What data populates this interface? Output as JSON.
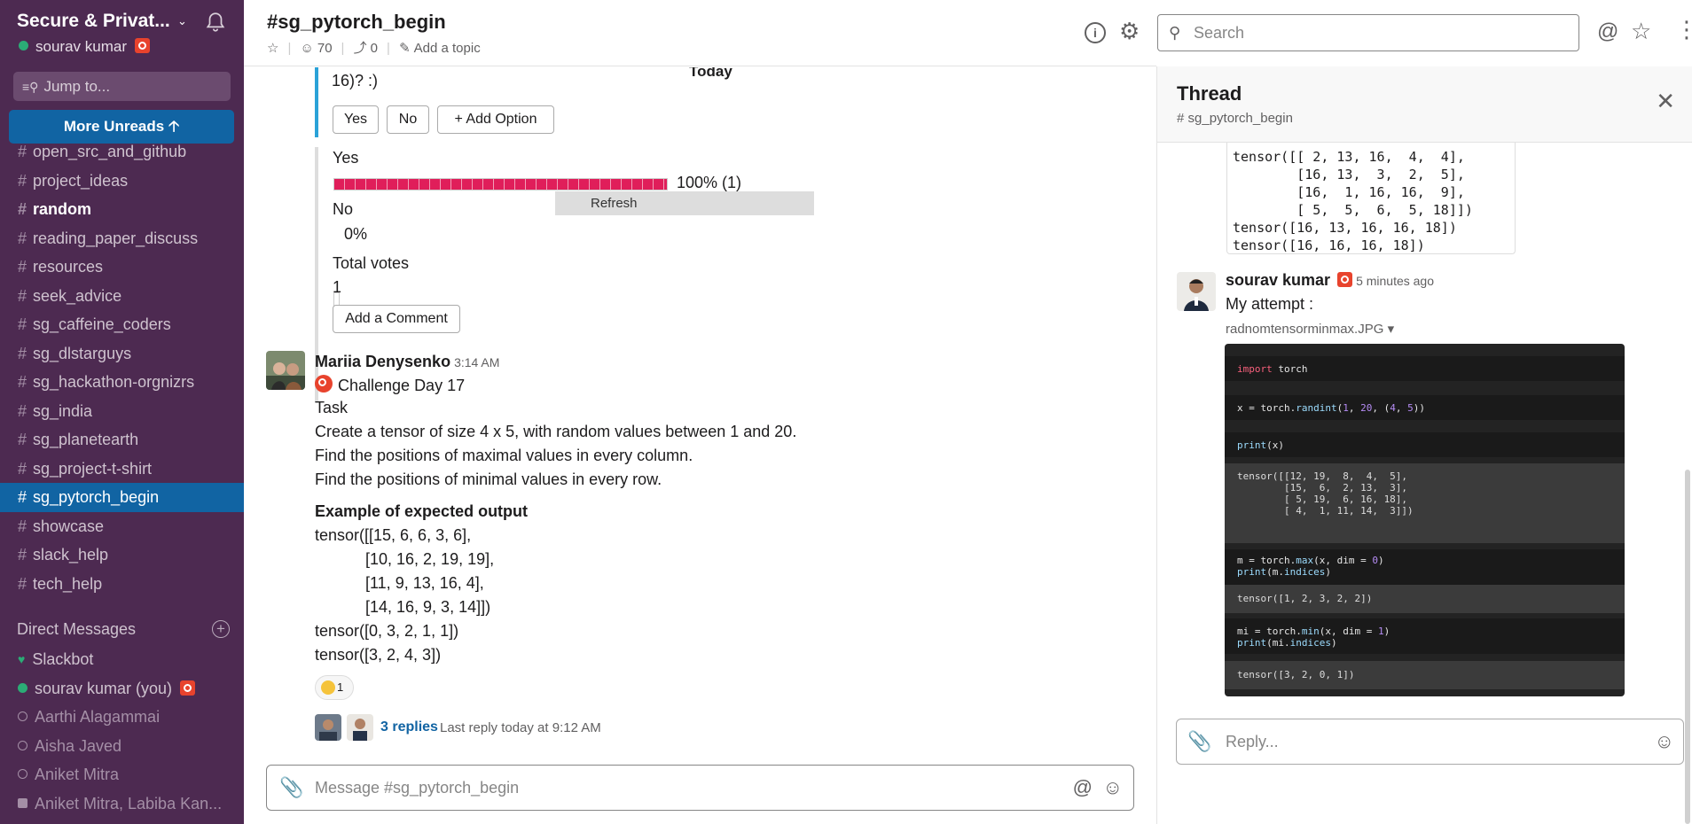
{
  "sidebar": {
    "workspace": "Secure & Privat...",
    "user": "sourav kumar",
    "jump": "Jump to...",
    "more_unreads": "More Unreads",
    "channels": [
      {
        "name": "open_src_and_github",
        "bold": false,
        "active": false
      },
      {
        "name": "project_ideas",
        "bold": false,
        "active": false
      },
      {
        "name": "random",
        "bold": true,
        "active": false
      },
      {
        "name": "reading_paper_discuss",
        "bold": false,
        "active": false
      },
      {
        "name": "resources",
        "bold": false,
        "active": false
      },
      {
        "name": "seek_advice",
        "bold": false,
        "active": false
      },
      {
        "name": "sg_caffeine_coders",
        "bold": false,
        "active": false
      },
      {
        "name": "sg_dlstarguys",
        "bold": false,
        "active": false
      },
      {
        "name": "sg_hackathon-orgnizrs",
        "bold": false,
        "active": false
      },
      {
        "name": "sg_india",
        "bold": false,
        "active": false
      },
      {
        "name": "sg_planetearth",
        "bold": false,
        "active": false
      },
      {
        "name": "sg_project-t-shirt",
        "bold": false,
        "active": false
      },
      {
        "name": "sg_pytorch_begin",
        "bold": false,
        "active": true
      },
      {
        "name": "showcase",
        "bold": false,
        "active": false
      },
      {
        "name": "slack_help",
        "bold": false,
        "active": false
      },
      {
        "name": "tech_help",
        "bold": false,
        "active": false
      }
    ],
    "dm_header": "Direct Messages",
    "dms": [
      {
        "name": "Slackbot",
        "presence": "heart"
      },
      {
        "name": "sourav kumar  (you)",
        "presence": "online"
      },
      {
        "name": "Aarthi Alagammai",
        "presence": "away"
      },
      {
        "name": "Aisha Javed",
        "presence": "away"
      },
      {
        "name": "Aniket Mitra",
        "presence": "away"
      },
      {
        "name": "Aniket Mitra, Labiba Kan...",
        "presence": "group"
      }
    ]
  },
  "header": {
    "channel": "#sg_pytorch_begin",
    "members": "70",
    "pins": "0",
    "topic": "Add a topic",
    "search_placeholder": "Search"
  },
  "poll": {
    "question_tail": "16)? :)",
    "today_label": "Today",
    "buttons": [
      "Yes",
      "No",
      "+ Add Option"
    ],
    "results": [
      {
        "label": "Yes",
        "fraction": 1.0,
        "text": "100% (1)"
      },
      {
        "label": "No",
        "fraction": 0.0,
        "text": "0%"
      }
    ],
    "refresh_label": "Refresh",
    "total_label": "Total votes",
    "total": "1",
    "add_comment": "Add a Comment"
  },
  "message": {
    "author": "Mariia Denysenko",
    "time": "3:14 AM",
    "title": "Challenge Day 17",
    "task_label": "Task",
    "lines": [
      "Create a tensor of size 4 x 5, with random values between 1 and 20.",
      "Find the positions of maximal values in every column.",
      "Find the positions of minimal values in every row."
    ],
    "example_label": "Example of expected output",
    "example": [
      "tensor([[15,  6,  6,  3,  6],",
      "[10, 16,  2, 19, 19],",
      "[11,  9, 13, 16,  4],",
      "[14, 16,  9,  3, 14]])",
      "tensor([0, 3, 2, 1, 1])",
      "tensor([3, 2, 4, 3])"
    ],
    "reaction_count": "1",
    "replies": "3 replies",
    "last_reply": "Last reply today at 9:12 AM"
  },
  "composer": {
    "placeholder": "Message #sg_pytorch_begin"
  },
  "thread": {
    "title": "Thread",
    "channel": "sg_pytorch_begin",
    "code": "tensor([[ 2, 13, 16,  4,  4],\n        [16, 13,  3,  2,  5],\n        [16,  1, 16, 16,  9],\n        [ 5,  5,  6,  5, 18]])\ntensor([16, 13, 16, 16, 18])\ntensor([16, 16, 16, 18])",
    "author": "sourav kumar",
    "time": "5 minutes ago",
    "text": "My attempt :",
    "file": "radnomtensorminmax.JPG",
    "reply_placeholder": "Reply..."
  },
  "colors": {
    "sidebar": "#4d2a51",
    "active": "#1164a3",
    "vote": "#e01e5a",
    "link": "#1264a3"
  }
}
